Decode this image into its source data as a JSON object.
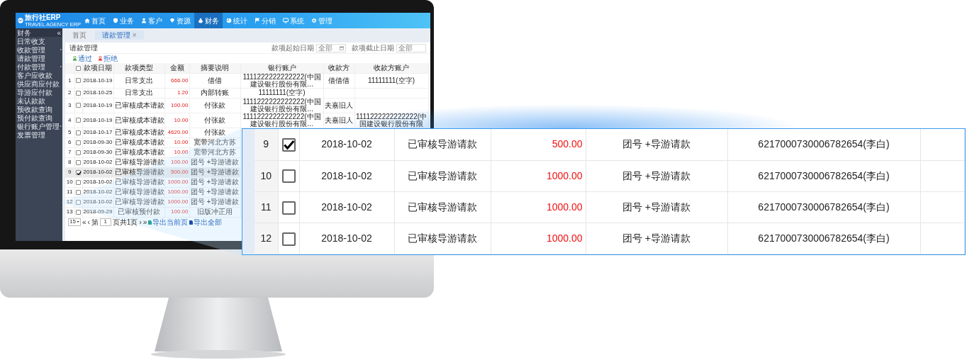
{
  "app": {
    "logo_title": "旅行社ERP",
    "logo_subtitle": "TRAVEL AGENCY ERP"
  },
  "top_nav": [
    {
      "label": "首页",
      "selected": false
    },
    {
      "label": "业务",
      "selected": false
    },
    {
      "label": "客户",
      "selected": false
    },
    {
      "label": "资源",
      "selected": false
    },
    {
      "label": "财务",
      "selected": true
    },
    {
      "label": "统计",
      "selected": false
    },
    {
      "label": "分销",
      "selected": false
    },
    {
      "label": "系统",
      "selected": false
    },
    {
      "label": "管理",
      "selected": false
    }
  ],
  "sidebar": {
    "title": "财务",
    "collapse_glyph": "«",
    "items": [
      {
        "label": "日常收支",
        "has_submenu": false
      },
      {
        "label": "收款管理",
        "has_submenu": true
      },
      {
        "label": "请款管理",
        "has_submenu": false
      },
      {
        "label": "付款管理",
        "has_submenu": true
      },
      {
        "label": "客户应收款",
        "has_submenu": false
      },
      {
        "label": "供应商应付款",
        "has_submenu": false
      },
      {
        "label": "导游应付款",
        "has_submenu": false
      },
      {
        "label": "未认款款",
        "has_submenu": false
      },
      {
        "label": "预收款查询",
        "has_submenu": false
      },
      {
        "label": "预付款查询",
        "has_submenu": false
      },
      {
        "label": "银行账户管理",
        "has_submenu": true
      },
      {
        "label": "发票管理",
        "has_submenu": false
      }
    ]
  },
  "tabs": [
    {
      "label": "首页",
      "selected": false,
      "closable": false
    },
    {
      "label": "请款管理",
      "selected": true,
      "closable": true
    }
  ],
  "close_glyph": "×",
  "panel": {
    "title": "请款管理",
    "actions": [
      {
        "label": "通过",
        "kind": "approve"
      },
      {
        "label": "拒绝",
        "kind": "reject"
      }
    ],
    "filters": [
      {
        "label": "款项起始日期",
        "placeholder": "全部",
        "calendar": true
      },
      {
        "label": "款项截止日期",
        "placeholder": "全部",
        "calendar": false
      }
    ]
  },
  "table": {
    "header_checked": false,
    "columns": [
      "款项日期",
      "款项类型",
      "金额",
      "摘要说明",
      "银行账户",
      "收款方",
      "收款方账户"
    ],
    "rows": [
      {
        "index": "1",
        "checked": false,
        "selected": false,
        "cells": [
          "2018-10-19",
          "日常支出",
          "666.00",
          "借借",
          "1111222222222222(中国建设银行股份有限...",
          "借借借",
          "11111111(空字)"
        ]
      },
      {
        "index": "2",
        "checked": false,
        "selected": false,
        "cells": [
          "2018-10-25",
          "日常支出",
          "1.20",
          "内部转账",
          "11111111(空字)",
          "",
          ""
        ]
      },
      {
        "index": "3",
        "checked": false,
        "selected": false,
        "cells": [
          "2018-10-19",
          "已审核成本请款",
          "100.00",
          "付张款",
          "1111222222222222(中国建设银行股份有限...",
          "夫嘉旧人",
          ""
        ]
      },
      {
        "index": "4",
        "checked": false,
        "selected": false,
        "cells": [
          "2018-10-19",
          "已审核成本请款",
          "10.00",
          "付张款",
          "1111222222222222(中国建设银行股份有限...",
          "夫嘉旧人",
          "1111222222222222(中国建设银行股份有限"
        ]
      },
      {
        "index": "5",
        "checked": false,
        "selected": false,
        "cells": [
          "2018-10-17",
          "已审核成本请款",
          "4620.00",
          "付张款"
        ]
      },
      {
        "index": "6",
        "checked": false,
        "selected": false,
        "cells": [
          "2018-09-30",
          "已审核成本请款",
          "10.00",
          "宽带河北方苏"
        ]
      },
      {
        "index": "7",
        "checked": false,
        "selected": false,
        "cells": [
          "2018-09-30",
          "已审核成本请款",
          "10.00",
          "宽带河北方苏"
        ]
      },
      {
        "index": "8",
        "checked": false,
        "selected": false,
        "cells": [
          "2018-10-02",
          "已审核导游请款",
          "100.00",
          "团号 +导游请款"
        ]
      },
      {
        "index": "9",
        "checked": true,
        "selected": true,
        "cells": [
          "2018-10-02",
          "已审核导游请款",
          "500.00",
          "团号 +导游请款"
        ]
      },
      {
        "index": "10",
        "checked": false,
        "selected": false,
        "cells": [
          "2018-10-02",
          "已审核导游请款",
          "1000.00",
          "团号 +导游请款"
        ]
      },
      {
        "index": "11",
        "checked": false,
        "selected": false,
        "cells": [
          "2018-10-02",
          "已审核导游请款",
          "1000.00",
          "团号 +导游请款"
        ]
      },
      {
        "index": "12",
        "checked": false,
        "selected": false,
        "cells": [
          "2018-10-02",
          "已审核导游请款",
          "1000.00",
          "团号 +导游请款"
        ]
      },
      {
        "index": "13",
        "checked": false,
        "selected": false,
        "cells": [
          "2018-09-29",
          "已审核预付款",
          "100.00",
          "旧版冲正用"
        ]
      }
    ]
  },
  "pagination": {
    "page_size": "15",
    "nav_glyphs": [
      "«",
      "‹",
      "›",
      "»"
    ],
    "page_prefix": "第",
    "page": "1",
    "page_suffix": "页共1页",
    "exports": [
      "导出当前页",
      "导出全部"
    ]
  },
  "callout": {
    "rows": [
      {
        "index": "9",
        "checked": true,
        "cells": [
          "2018-10-02",
          "已审核导游请款",
          "500.00",
          "团号 +导游请款",
          "6217000730006782654(李白)"
        ]
      },
      {
        "index": "10",
        "checked": false,
        "cells": [
          "2018-10-02",
          "已审核导游请款",
          "1000.00",
          "团号 +导游请款",
          "6217000730006782654(李白)"
        ]
      },
      {
        "index": "11",
        "checked": false,
        "cells": [
          "2018-10-02",
          "已审核导游请款",
          "1000.00",
          "团号 +导游请款",
          "6217000730006782654(李白)"
        ]
      },
      {
        "index": "12",
        "checked": false,
        "cells": [
          "2018-10-02",
          "已审核导游请款",
          "1000.00",
          "团号 +导游请款",
          "6217000730006782654(李白)"
        ]
      }
    ]
  }
}
